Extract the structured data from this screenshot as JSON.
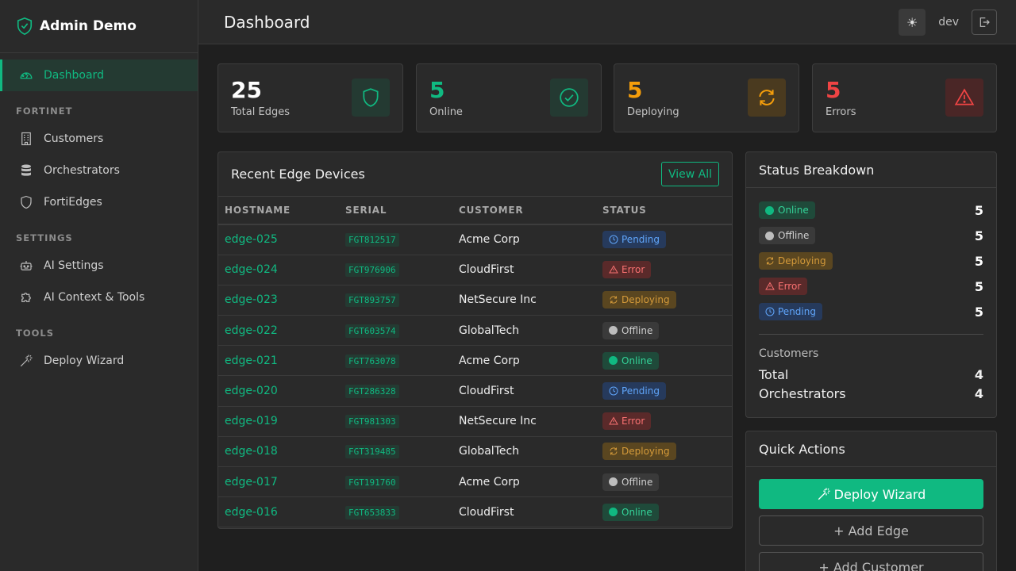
{
  "brand": {
    "title": "Admin Demo"
  },
  "sidebar": {
    "dashboard": "Dashboard",
    "section_fortinet": "FORTINET",
    "customers": "Customers",
    "orchestrators": "Orchestrators",
    "fortiedges": "FortiEdges",
    "section_settings": "SETTINGS",
    "ai_settings": "AI Settings",
    "ai_context": "AI Context & Tools",
    "section_tools": "TOOLS",
    "deploy_wizard": "Deploy Wizard"
  },
  "header": {
    "title": "Dashboard",
    "theme_icon": "☀",
    "user": "dev"
  },
  "stats": {
    "total": {
      "value": "25",
      "label": "Total Edges",
      "color": "#ffffff"
    },
    "online": {
      "value": "5",
      "label": "Online",
      "color": "#10b981"
    },
    "deploying": {
      "value": "5",
      "label": "Deploying",
      "color": "#f59e0b"
    },
    "errors": {
      "value": "5",
      "label": "Errors",
      "color": "#ef4444"
    }
  },
  "recent": {
    "title": "Recent Edge Devices",
    "view_all": "View All",
    "columns": {
      "hostname": "HOSTNAME",
      "serial": "SERIAL",
      "customer": "CUSTOMER",
      "status": "STATUS"
    },
    "rows": [
      {
        "hostname": "edge-025",
        "serial": "FGT812517",
        "customer": "Acme Corp",
        "status": "Pending"
      },
      {
        "hostname": "edge-024",
        "serial": "FGT976906",
        "customer": "CloudFirst",
        "status": "Error"
      },
      {
        "hostname": "edge-023",
        "serial": "FGT893757",
        "customer": "NetSecure Inc",
        "status": "Deploying"
      },
      {
        "hostname": "edge-022",
        "serial": "FGT603574",
        "customer": "GlobalTech",
        "status": "Offline"
      },
      {
        "hostname": "edge-021",
        "serial": "FGT763078",
        "customer": "Acme Corp",
        "status": "Online"
      },
      {
        "hostname": "edge-020",
        "serial": "FGT286328",
        "customer": "CloudFirst",
        "status": "Pending"
      },
      {
        "hostname": "edge-019",
        "serial": "FGT981303",
        "customer": "NetSecure Inc",
        "status": "Error"
      },
      {
        "hostname": "edge-018",
        "serial": "FGT319485",
        "customer": "GlobalTech",
        "status": "Deploying"
      },
      {
        "hostname": "edge-017",
        "serial": "FGT191760",
        "customer": "Acme Corp",
        "status": "Offline"
      },
      {
        "hostname": "edge-016",
        "serial": "FGT653833",
        "customer": "CloudFirst",
        "status": "Online"
      }
    ]
  },
  "breakdown": {
    "title": "Status Breakdown",
    "items": [
      {
        "status": "Online",
        "count": "5"
      },
      {
        "status": "Offline",
        "count": "5"
      },
      {
        "status": "Deploying",
        "count": "5"
      },
      {
        "status": "Error",
        "count": "5"
      },
      {
        "status": "Pending",
        "count": "5"
      }
    ],
    "customers_label": "Customers",
    "total_label": "Total",
    "total_value": "4",
    "orchestrators_label": "Orchestrators",
    "orchestrators_value": "4"
  },
  "quick_actions": {
    "title": "Quick Actions",
    "deploy_wizard": "Deploy Wizard",
    "add_edge": "+ Add Edge",
    "add_customer": "+ Add Customer"
  }
}
